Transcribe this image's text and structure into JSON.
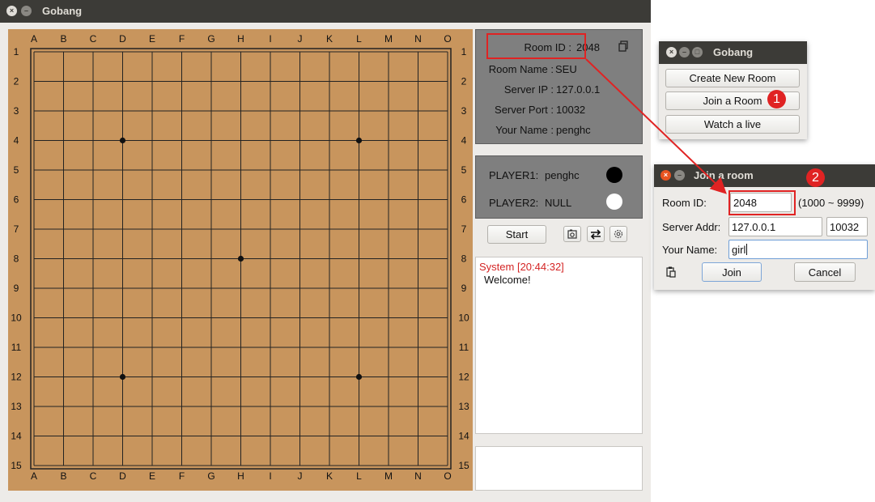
{
  "main_window": {
    "title": "Gobang",
    "board": {
      "columns": [
        "A",
        "B",
        "C",
        "D",
        "E",
        "F",
        "G",
        "H",
        "I",
        "J",
        "K",
        "L",
        "M",
        "N",
        "O"
      ],
      "rows": [
        "1",
        "2",
        "3",
        "4",
        "5",
        "6",
        "7",
        "8",
        "9",
        "10",
        "11",
        "12",
        "13",
        "14",
        "15"
      ],
      "star_points": [
        [
          3,
          3
        ],
        [
          11,
          3
        ],
        [
          7,
          7
        ],
        [
          3,
          11
        ],
        [
          11,
          11
        ]
      ]
    },
    "room_info": {
      "room_id_label": "Room   ID :",
      "room_id": "2048",
      "room_name_label": "Room Name :",
      "room_name": "SEU",
      "server_ip_label": "Server IP :",
      "server_ip": "127.0.0.1",
      "server_port_label": "Server Port :",
      "server_port": "10032",
      "your_name_label": "Your Name :",
      "your_name": "penghc",
      "copy_icon": "copy-icon"
    },
    "players": {
      "p1_label": "PLAYER1:",
      "p1_name": "penghc",
      "p1_color": "#000000",
      "p2_label": "PLAYER2:",
      "p2_name": "NULL",
      "p2_color": "#ffffff"
    },
    "controls": {
      "start_label": "Start",
      "icons": [
        "screenshot-icon",
        "swap-icon",
        "settings-icon"
      ]
    },
    "chat": {
      "sender": "System [20:44:32]",
      "message": "Welcome!",
      "sender_color": "#d42424"
    }
  },
  "lobby_window": {
    "title": "Gobang",
    "create_label": "Create New Room",
    "join_label": "Join a Room",
    "watch_label": "Watch a live",
    "step_badge": "1"
  },
  "join_window": {
    "title": "Join a room",
    "room_id_label": "Room ID:",
    "room_id_value": "2048",
    "room_id_range": "(1000 ~ 9999)",
    "server_addr_label": "Server Addr:",
    "server_addr_value": "127.0.0.1",
    "server_port_value": "10032",
    "your_name_label": "Your Name:",
    "your_name_value": "girl",
    "join_label": "Join",
    "cancel_label": "Cancel",
    "paste_icon": "paste-icon",
    "step_badge": "2"
  },
  "annotation_color": "#e02323"
}
